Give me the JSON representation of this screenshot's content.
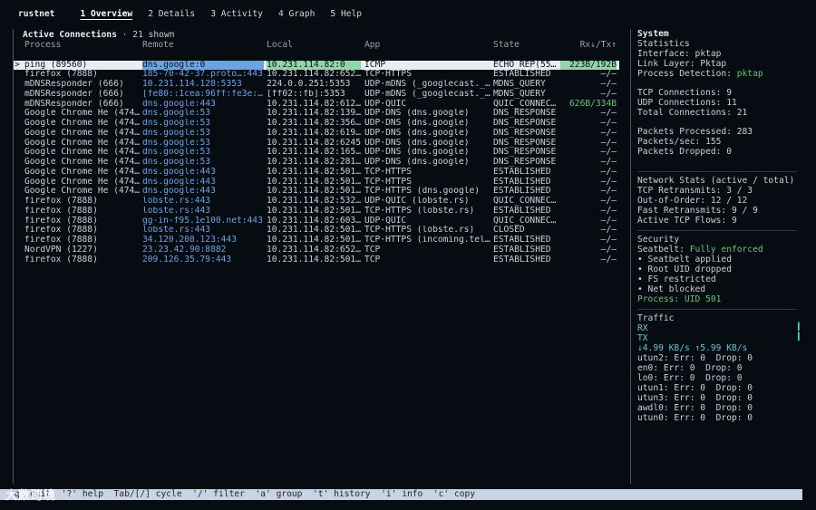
{
  "tabs": [
    "rustnet",
    "1 Overview",
    "2 Details",
    "3 Activity",
    "4 Graph",
    "5 Help"
  ],
  "connections": {
    "title": "Active Connections",
    "count_text": "· 21 shown",
    "columns": [
      "Process",
      "Remote",
      "Local",
      "App",
      "State",
      "Rx↓/Tx↑"
    ],
    "selected_marker": ">",
    "rows": [
      {
        "process": "ping (89560)",
        "remote": "dns.google:0",
        "local": "10.231.114.82:0",
        "app": "ICMP",
        "state": "ECHO_REP(55…",
        "rxtx": "223B/192B"
      },
      {
        "process": "firefox (7888)",
        "remote": "185-70-42-37.proto…:443",
        "local": "10.231.114.82:652…",
        "app": "TCP·HTTPS",
        "state": "ESTABLISHED",
        "rxtx": "–/–"
      },
      {
        "process": "mDNSResponder (666)",
        "remote": "10.231.114.128:5353",
        "local": "224.0.0.251:5353",
        "app": "UDP·mDNS (_googlecast._…",
        "state": "MDNS_QUERY",
        "rxtx": "–/–"
      },
      {
        "process": "mDNSResponder (666)",
        "remote": "[fe80::1cea:96ff:fe3e:…",
        "local": "[ff02::fb]:5353",
        "app": "UDP·mDNS (_googlecast._…",
        "state": "MDNS_QUERY",
        "rxtx": "–/–"
      },
      {
        "process": "mDNSResponder (666)",
        "remote": "dns.google:443",
        "local": "10.231.114.82:612…",
        "app": "UDP·QUIC",
        "state": "QUIC_CONNEC…",
        "rxtx": "626B/334B"
      },
      {
        "process": "Google Chrome He (474…",
        "remote": "dns.google:53",
        "local": "10.231.114.82:139…",
        "app": "UDP·DNS (dns.google)",
        "state": "DNS_RESPONSE",
        "rxtx": "–/–"
      },
      {
        "process": "Google Chrome He (474…",
        "remote": "dns.google:53",
        "local": "10.231.114.82:356…",
        "app": "UDP·DNS (dns.google)",
        "state": "DNS_RESPONSE",
        "rxtx": "–/–"
      },
      {
        "process": "Google Chrome He (474…",
        "remote": "dns.google:53",
        "local": "10.231.114.82:619…",
        "app": "UDP·DNS (dns.google)",
        "state": "DNS_RESPONSE",
        "rxtx": "–/–"
      },
      {
        "process": "Google Chrome He (474…",
        "remote": "dns.google:53",
        "local": "10.231.114.82:6245",
        "app": "UDP·DNS (dns.google)",
        "state": "DNS_RESPONSE",
        "rxtx": "–/–"
      },
      {
        "process": "Google Chrome He (474…",
        "remote": "dns.google:53",
        "local": "10.231.114.82:165…",
        "app": "UDP·DNS (dns.google)",
        "state": "DNS_RESPONSE",
        "rxtx": "–/–"
      },
      {
        "process": "Google Chrome He (474…",
        "remote": "dns.google:53",
        "local": "10.231.114.82:281…",
        "app": "UDP·DNS (dns.google)",
        "state": "DNS_RESPONSE",
        "rxtx": "–/–"
      },
      {
        "process": "Google Chrome He (474…",
        "remote": "dns.google:443",
        "local": "10.231.114.82:501…",
        "app": "TCP·HTTPS",
        "state": "ESTABLISHED",
        "rxtx": "–/–"
      },
      {
        "process": "Google Chrome He (474…",
        "remote": "dns.google:443",
        "local": "10.231.114.82:501…",
        "app": "TCP·HTTPS",
        "state": "ESTABLISHED",
        "rxtx": "–/–"
      },
      {
        "process": "Google Chrome He (474…",
        "remote": "dns.google:443",
        "local": "10.231.114.82:501…",
        "app": "TCP·HTTPS (dns.google)",
        "state": "ESTABLISHED",
        "rxtx": "–/–"
      },
      {
        "process": "firefox (7888)",
        "remote": "lobste.rs:443",
        "local": "10.231.114.82:532…",
        "app": "UDP·QUIC (lobste.rs)",
        "state": "QUIC_CONNEC…",
        "rxtx": "–/–"
      },
      {
        "process": "firefox (7888)",
        "remote": "lobste.rs:443",
        "local": "10.231.114.82:501…",
        "app": "TCP·HTTPS (lobste.rs)",
        "state": "ESTABLISHED",
        "rxtx": "–/–"
      },
      {
        "process": "firefox (7888)",
        "remote": "gg-in-f95.1e100.net:443",
        "local": "10.231.114.82:603…",
        "app": "UDP·QUIC",
        "state": "QUIC_CONNEC…",
        "rxtx": "–/–"
      },
      {
        "process": "firefox (7888)",
        "remote": "lobste.rs:443",
        "local": "10.231.114.82:501…",
        "app": "TCP·HTTPS (lobste.rs)",
        "state": "CLOSED",
        "rxtx": "–/–"
      },
      {
        "process": "firefox (7888)",
        "remote": "34.120.208.123:443",
        "local": "10.231.114.82:501…",
        "app": "TCP·HTTPS (incoming.tel…",
        "state": "ESTABLISHED",
        "rxtx": "–/–"
      },
      {
        "process": "NordVPN (1227)",
        "remote": "23.23.42.90:8882",
        "local": "10.231.114.82:652…",
        "app": "TCP",
        "state": "ESTABLISHED",
        "rxtx": "–/–"
      },
      {
        "process": "firefox (7888)",
        "remote": "209.126.35.79:443",
        "local": "10.231.114.82:501…",
        "app": "TCP",
        "state": "ESTABLISHED",
        "rxtx": "–/–"
      }
    ]
  },
  "system": {
    "title": "System",
    "stats_heading": "Statistics",
    "interface_label": "Interface: ",
    "interface": "pktap",
    "link_label": "Link Layer: ",
    "link": "Pktap",
    "detection_label": "Process Detection: ",
    "detection": "pktap",
    "tcp_conn": "TCP Connections: 9",
    "udp_conn": "UDP Connections: 11",
    "total_conn": "Total Connections: 21",
    "packets_processed": "Packets Processed: 283",
    "packets_sec": "Packets/sec: 155",
    "packets_dropped": "Packets Dropped: 0",
    "net_heading": "Network Stats (active / total)",
    "tcp_retrans": "TCP Retransmits: 3 / 3",
    "out_of_order": "Out-of-Order: 12 / 12",
    "fast_retrans": "Fast Retransmits: 9 / 9",
    "active_flows": "Active TCP Flows: 9",
    "security_heading": "Security",
    "seatbelt_label": "Seatbelt: ",
    "seatbelt": "Fully enforced",
    "sec_items": [
      "• Seatbelt applied",
      "• Root UID dropped",
      "• FS restricted",
      "• Net blocked"
    ],
    "process_uid": "Process: UID 501",
    "traffic_heading": "Traffic",
    "rx_label": "RX",
    "tx_label": "TX",
    "rates": "↓4.99 KB/s ↑5.99 KB/s",
    "ifaces": [
      "utun2: Err: 0  Drop: 0",
      "en0: Err: 0  Drop: 0",
      "lo0: Err: 0  Drop: 0",
      "utun1: Err: 0  Drop: 0",
      "utun3: Err: 0  Drop: 0",
      "awdl0: Err: 0  Drop: 0",
      "utun0: Err: 0  Drop: 0"
    ]
  },
  "footer": {
    "text": "'q' quit  '?' help  Tab/[/] cycle  '/' filter  'a' group  't' history  'i' info  'c' copy"
  },
  "watermark": "大数跨境",
  "colors": {
    "accent_green": "#62c67a",
    "accent_cyan": "#5ec9d6",
    "remote_blue": "#6aa4e6"
  }
}
